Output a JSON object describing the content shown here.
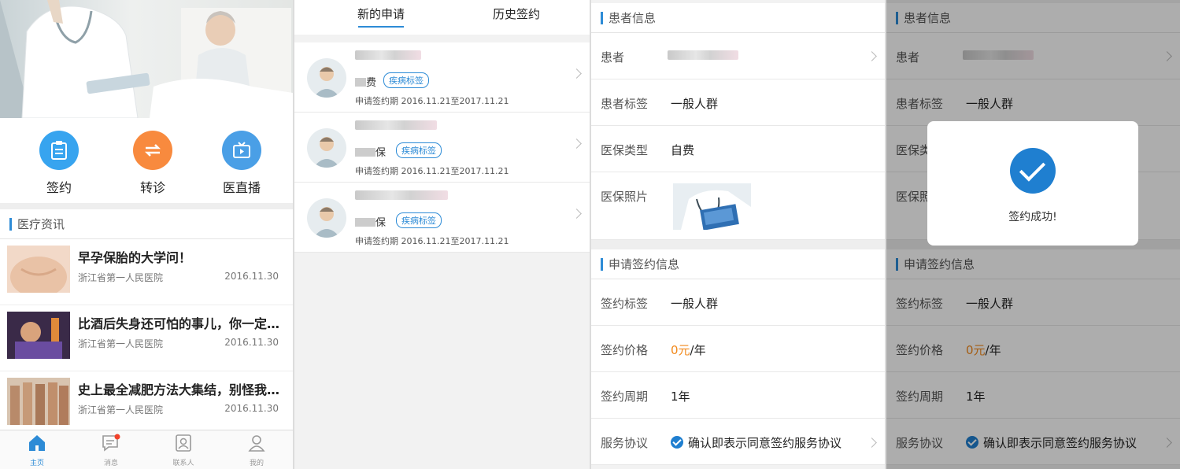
{
  "home": {
    "quick": [
      {
        "label": "签约",
        "icon": "sign-icon",
        "color": "#37a4ef"
      },
      {
        "label": "转诊",
        "icon": "transfer-icon",
        "color": "#f88a3e"
      },
      {
        "label": "医直播",
        "icon": "live-icon",
        "color": "#4a9fe6"
      }
    ],
    "news_section": "医疗资讯",
    "news": [
      {
        "title": "早孕保胎的大学问！",
        "source": "浙江省第一人民医院",
        "date": "2016.11.30"
      },
      {
        "title": "比酒后失身还可怕的事儿，你一定…",
        "source": "浙江省第一人民医院",
        "date": "2016.11.30"
      },
      {
        "title": "史上最全减肥方法大集结，别怪我…",
        "source": "浙江省第一人民医院",
        "date": "2016.11.30"
      }
    ],
    "tabbar": [
      {
        "label": "主页",
        "icon": "home-icon",
        "active": true
      },
      {
        "label": "消息",
        "icon": "message-icon",
        "badge": true
      },
      {
        "label": "联系人",
        "icon": "contacts-icon"
      },
      {
        "label": "我的",
        "icon": "profile-icon"
      }
    ]
  },
  "requests": {
    "tabs": [
      "新的申请",
      "历史签约"
    ],
    "items": [
      {
        "type_suffix": "费",
        "tag": "疾病标签",
        "period": "申请签约期  2016.11.21至2017.11.21"
      },
      {
        "type_suffix": "保",
        "tag": "疾病标签",
        "period": "申请签约期  2016.11.21至2017.11.21"
      },
      {
        "type_suffix": "保",
        "tag": "疾病标签",
        "period": "申请签约期  2016.11.21至2017.11.21"
      }
    ]
  },
  "detail": {
    "patient_section": "患者信息",
    "patient_label": "患者",
    "tag_label": "患者标签",
    "tag_value": "一般人群",
    "insurance_label": "医保类型",
    "insurance_value": "自费",
    "photo_label": "医保照片",
    "sign_section": "申请签约信息",
    "sign_tag_label": "签约标签",
    "sign_tag_value": "一般人群",
    "price_label": "签约价格",
    "price_amount": "0元",
    "price_unit": "/年",
    "cycle_label": "签约周期",
    "cycle_value": "1年",
    "agreement_label": "服务协议",
    "agreement_text": "确认即表示同意签约服务协议"
  },
  "modal": {
    "message": "签约成功!"
  }
}
